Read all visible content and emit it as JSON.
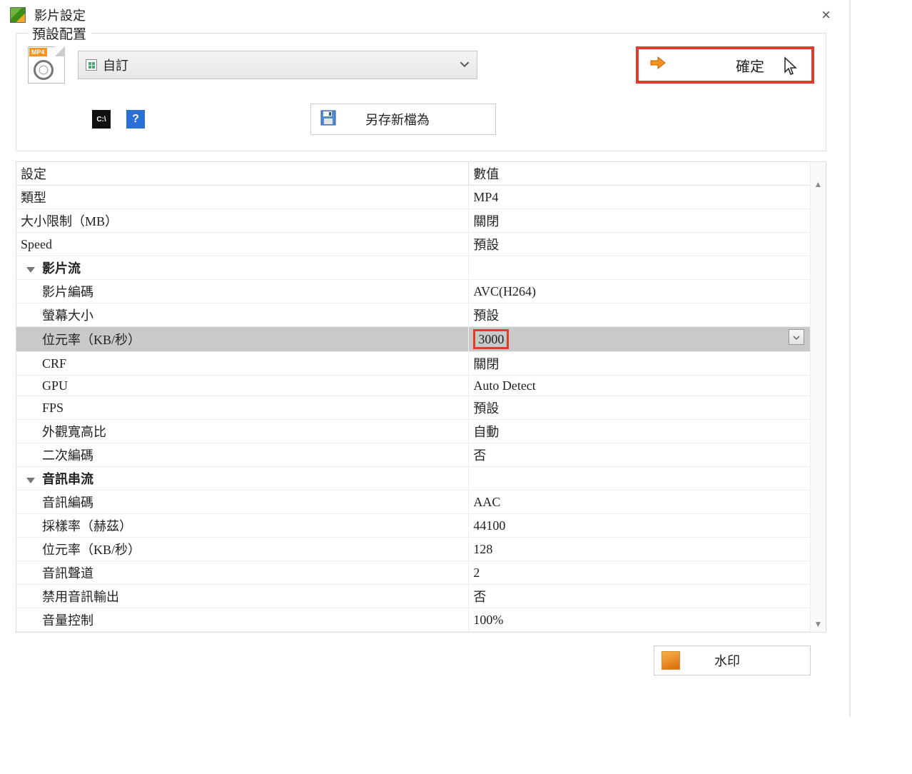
{
  "titlebar": {
    "title": "影片設定"
  },
  "preset": {
    "legend": "預設配置",
    "format_badge": "MP4",
    "selected": "自訂",
    "confirm_label": "確定",
    "save_as_label": "另存新檔為"
  },
  "table": {
    "header_setting": "設定",
    "header_value": "數值",
    "rows": [
      {
        "label": "類型",
        "value": "MP4",
        "indent": 0
      },
      {
        "label": "大小限制（MB）",
        "value": "關閉",
        "indent": 0
      },
      {
        "label": "Speed",
        "value": "預設",
        "indent": 0
      }
    ],
    "video_group": "影片流",
    "video_rows": [
      {
        "label": "影片編碼",
        "value": "AVC(H264)"
      },
      {
        "label": "螢幕大小",
        "value": "預設"
      },
      {
        "label": "位元率（KB/秒）",
        "value": "3000",
        "active": true
      },
      {
        "label": "CRF",
        "value": "關閉"
      },
      {
        "label": "GPU",
        "value": "Auto Detect"
      },
      {
        "label": "FPS",
        "value": "預設"
      },
      {
        "label": "外觀寬高比",
        "value": "自動"
      },
      {
        "label": "二次編碼",
        "value": "否"
      }
    ],
    "audio_group": "音訊串流",
    "audio_rows": [
      {
        "label": "音訊編碼",
        "value": "AAC"
      },
      {
        "label": "採樣率（赫茲）",
        "value": "44100"
      },
      {
        "label": "位元率（KB/秒）",
        "value": "128"
      },
      {
        "label": "音訊聲道",
        "value": "2"
      },
      {
        "label": "禁用音訊輸出",
        "value": "否"
      },
      {
        "label": "音量控制",
        "value": "100%"
      }
    ]
  },
  "footer": {
    "watermark_label": "水印"
  }
}
